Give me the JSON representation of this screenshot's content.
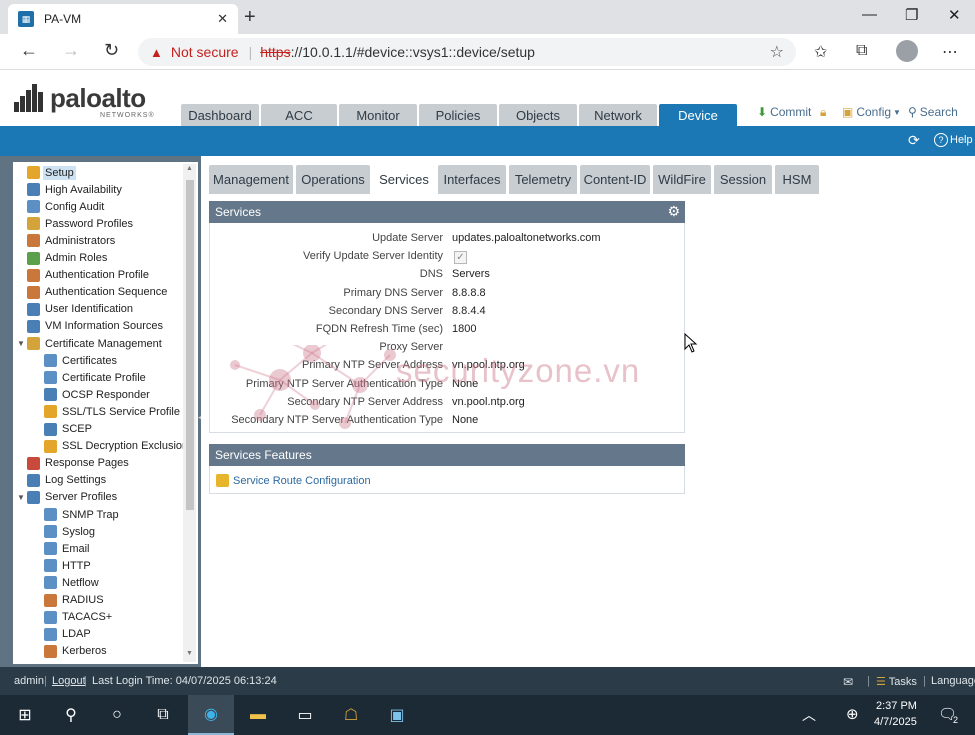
{
  "browser": {
    "tab_title": "PA-VM",
    "new_tab": "+",
    "close": "✕",
    "not_secure": "Not secure",
    "url_scheme": "https",
    "url_rest": "://10.0.1.1/#device::vsys1::device/setup"
  },
  "app": {
    "logo_text": "paloalto",
    "logo_sub": "NETWORKS®",
    "main_tabs": [
      "Dashboard",
      "ACC",
      "Monitor",
      "Policies",
      "Objects",
      "Network",
      "Device"
    ],
    "commit": "Commit",
    "config": "Config",
    "search": "Search",
    "help": "Help"
  },
  "sidebar": {
    "items": [
      {
        "label": "Setup",
        "level": 0,
        "selected": true,
        "icon": "setup-icon",
        "color": "#e3a62b"
      },
      {
        "label": "High Availability",
        "level": 0,
        "icon": "ha-icon",
        "color": "#4a7fb5"
      },
      {
        "label": "Config Audit",
        "level": 0,
        "icon": "audit-icon",
        "color": "#5c8fc4"
      },
      {
        "label": "Password Profiles",
        "level": 0,
        "icon": "password-icon",
        "color": "#d4a43a"
      },
      {
        "label": "Administrators",
        "level": 0,
        "icon": "admin-icon",
        "color": "#c9773a"
      },
      {
        "label": "Admin Roles",
        "level": 0,
        "icon": "roles-icon",
        "color": "#5aa04a"
      },
      {
        "label": "Authentication Profile",
        "level": 0,
        "icon": "auth-profile-icon",
        "color": "#c9773a"
      },
      {
        "label": "Authentication Sequence",
        "level": 0,
        "icon": "auth-seq-icon",
        "color": "#c9773a"
      },
      {
        "label": "User Identification",
        "level": 0,
        "icon": "userid-icon",
        "color": "#4a7fb5"
      },
      {
        "label": "VM Information Sources",
        "level": 0,
        "icon": "vm-icon",
        "color": "#4a7fb5"
      },
      {
        "label": "Certificate Management",
        "level": 0,
        "expanded": true,
        "icon": "cert-mgmt-icon",
        "color": "#d4a43a"
      },
      {
        "label": "Certificates",
        "level": 1,
        "icon": "cert-icon",
        "color": "#5c8fc4"
      },
      {
        "label": "Certificate Profile",
        "level": 1,
        "icon": "cert-profile-icon",
        "color": "#5c8fc4"
      },
      {
        "label": "OCSP Responder",
        "level": 1,
        "icon": "ocsp-icon",
        "color": "#4a7fb5"
      },
      {
        "label": "SSL/TLS Service Profile",
        "level": 1,
        "icon": "lock-icon",
        "color": "#e3a62b"
      },
      {
        "label": "SCEP",
        "level": 1,
        "icon": "scep-icon",
        "color": "#4a7fb5"
      },
      {
        "label": "SSL Decryption Exclusion",
        "level": 1,
        "icon": "lock-icon",
        "color": "#e3a62b"
      },
      {
        "label": "Response Pages",
        "level": 0,
        "icon": "response-icon",
        "color": "#c94a3a"
      },
      {
        "label": "Log Settings",
        "level": 0,
        "icon": "log-icon",
        "color": "#4a7fb5"
      },
      {
        "label": "Server Profiles",
        "level": 0,
        "expanded": true,
        "icon": "server-profiles-icon",
        "color": "#4a7fb5"
      },
      {
        "label": "SNMP Trap",
        "level": 1,
        "icon": "snmp-icon",
        "color": "#5c8fc4"
      },
      {
        "label": "Syslog",
        "level": 1,
        "icon": "syslog-icon",
        "color": "#5c8fc4"
      },
      {
        "label": "Email",
        "level": 1,
        "icon": "email-icon",
        "color": "#5c8fc4"
      },
      {
        "label": "HTTP",
        "level": 1,
        "icon": "http-icon",
        "color": "#5c8fc4"
      },
      {
        "label": "Netflow",
        "level": 1,
        "icon": "netflow-icon",
        "color": "#5c8fc4"
      },
      {
        "label": "RADIUS",
        "level": 1,
        "icon": "radius-icon",
        "color": "#c9773a"
      },
      {
        "label": "TACACS+",
        "level": 1,
        "icon": "tacacs-icon",
        "color": "#5c8fc4"
      },
      {
        "label": "LDAP",
        "level": 1,
        "icon": "ldap-icon",
        "color": "#5c8fc4"
      },
      {
        "label": "Kerberos",
        "level": 1,
        "icon": "kerberos-icon",
        "color": "#c9773a"
      }
    ]
  },
  "subtabs": [
    "Management",
    "Operations",
    "Services",
    "Interfaces",
    "Telemetry",
    "Content-ID",
    "WildFire",
    "Session",
    "HSM"
  ],
  "services": {
    "title": "Services",
    "rows": [
      {
        "label": "Update Server",
        "value": "updates.paloaltonetworks.com"
      },
      {
        "label": "Verify Update Server Identity",
        "value": "",
        "checkbox": true
      },
      {
        "label": "DNS",
        "value": "Servers"
      },
      {
        "label": "Primary DNS Server",
        "value": "8.8.8.8"
      },
      {
        "label": "Secondary DNS Server",
        "value": "8.8.4.4"
      },
      {
        "label": "FQDN Refresh Time (sec)",
        "value": "1800"
      },
      {
        "label": "Proxy Server",
        "value": ""
      },
      {
        "label": "Primary NTP Server Address",
        "value": "vn.pool.ntp.org"
      },
      {
        "label": "Primary NTP Server Authentication Type",
        "value": "None"
      },
      {
        "label": "Secondary NTP Server Address",
        "value": "vn.pool.ntp.org"
      },
      {
        "label": "Secondary NTP Server Authentication Type",
        "value": "None"
      }
    ]
  },
  "services_features": {
    "title": "Services Features",
    "link": "Service Route Configuration"
  },
  "watermark": "securityzone.vn",
  "status": {
    "user": "admin",
    "logout": "Logout",
    "last_login": "Last Login Time: 04/07/2025 06:13:24",
    "tasks": "Tasks",
    "language": "Language"
  },
  "taskbar": {
    "time": "2:37 PM",
    "date": "4/7/2025",
    "notifications": "2"
  }
}
